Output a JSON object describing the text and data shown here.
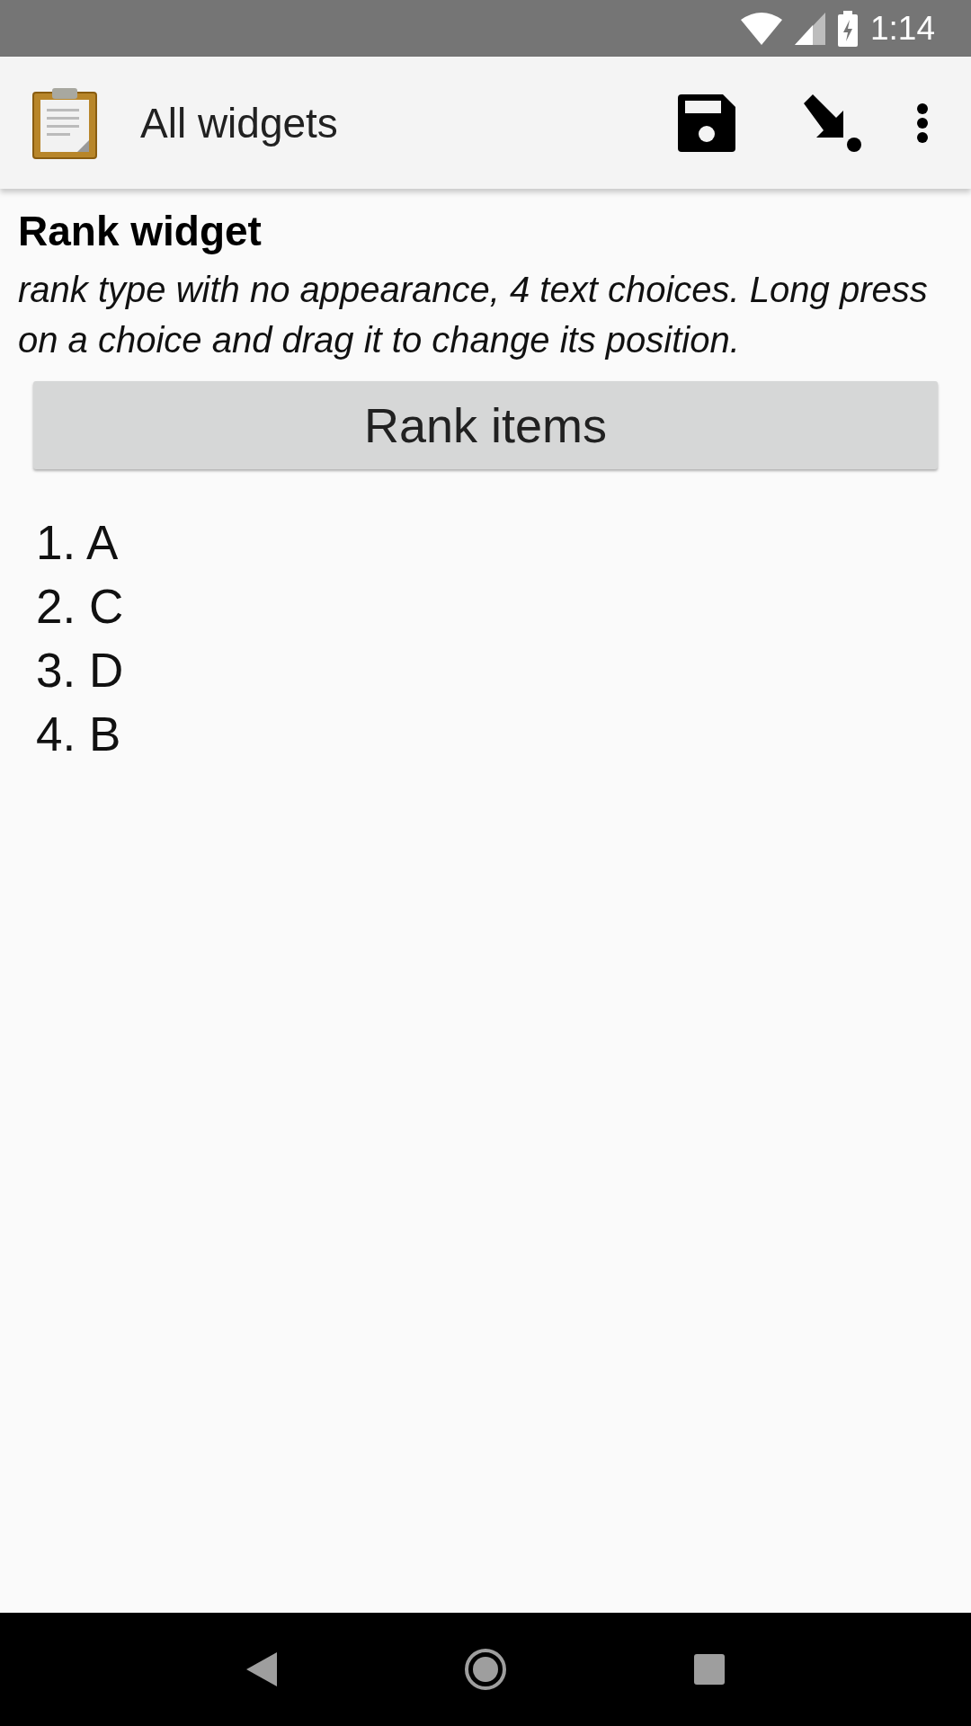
{
  "status_bar": {
    "time": "1:14"
  },
  "app_bar": {
    "title": "All widgets"
  },
  "question": {
    "label": "Rank widget",
    "hint": "rank type with no appearance, 4 text choices. Long press on a choice and drag it to change its position."
  },
  "rank_button": {
    "label": "Rank items"
  },
  "ranked_items": [
    "1. A",
    "2. C",
    "3. D",
    "4. B"
  ]
}
